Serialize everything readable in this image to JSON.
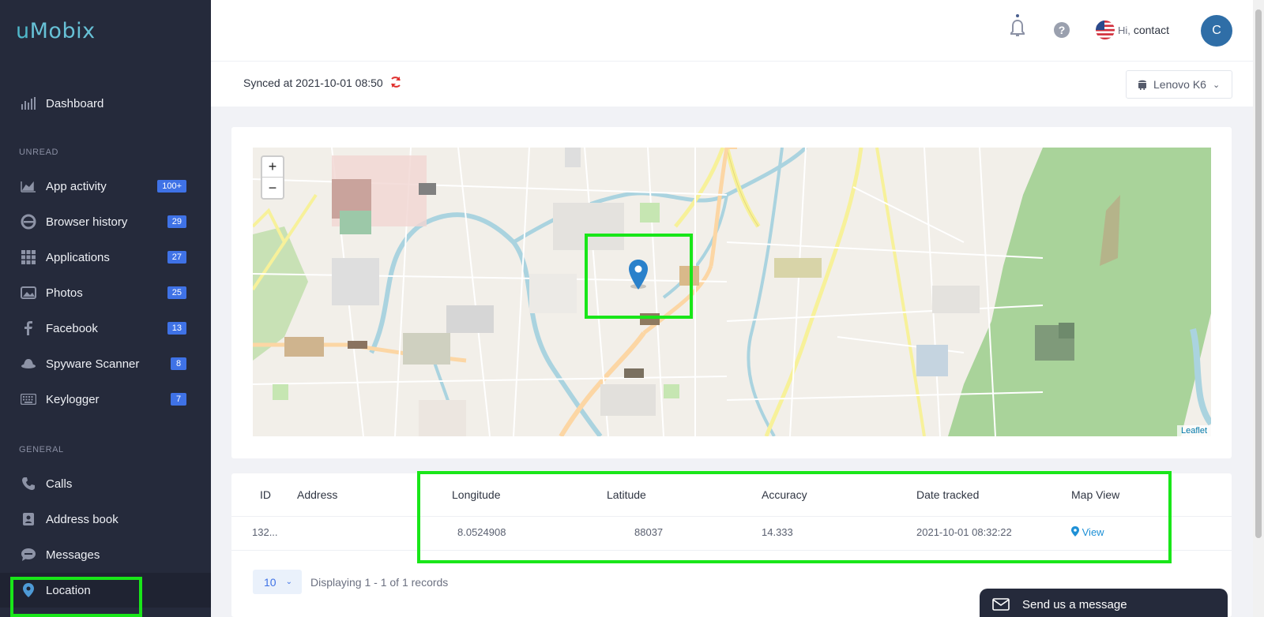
{
  "app": {
    "logo_u": "u",
    "logo_rest": "Mobix"
  },
  "sidebar": {
    "dashboard": "Dashboard",
    "unread_label": "UNREAD",
    "general_label": "GENERAL",
    "unread": [
      {
        "label": "App activity",
        "badge": "100+",
        "icon": "chart-icon"
      },
      {
        "label": "Browser history",
        "badge": "29",
        "icon": "browser-icon"
      },
      {
        "label": "Applications",
        "badge": "27",
        "icon": "grid-icon"
      },
      {
        "label": "Photos",
        "badge": "25",
        "icon": "photos-icon"
      },
      {
        "label": "Facebook",
        "badge": "13",
        "icon": "facebook-icon"
      },
      {
        "label": "Spyware Scanner",
        "badge": "8",
        "icon": "spy-icon"
      },
      {
        "label": "Keylogger",
        "badge": "7",
        "icon": "keyboard-icon"
      }
    ],
    "general": [
      {
        "label": "Calls",
        "icon": "phone-icon"
      },
      {
        "label": "Address book",
        "icon": "contacts-icon"
      },
      {
        "label": "Messages",
        "icon": "sms-icon"
      },
      {
        "label": "Location",
        "icon": "location-pin-icon"
      }
    ]
  },
  "header": {
    "hi": "Hi,",
    "user": "contact",
    "avatar_letter": "C",
    "synced": "Synced at 2021-10-01 08:50",
    "device": "Lenovo K6"
  },
  "map": {
    "zoom_in": "+",
    "zoom_out": "−",
    "attribution": "Leaflet"
  },
  "table": {
    "headers": [
      "ID",
      "Address",
      "Longitude",
      "Latitude",
      "Accuracy",
      "Date tracked",
      "Map View"
    ],
    "row": {
      "id": "132...",
      "address": "",
      "longitude": "8.0524908",
      "latitude": "88037",
      "accuracy": "14.333",
      "date": "2021-10-01 08:32:22",
      "view": "View"
    },
    "per_page": "10",
    "displaying": "Displaying 1 - 1 of 1 records"
  },
  "chat": {
    "label": "Send us a message"
  },
  "colors": {
    "sidebar": "#252a3b",
    "accent": "#3f72e6",
    "highlight": "#19e619",
    "link": "#1e90d6"
  }
}
